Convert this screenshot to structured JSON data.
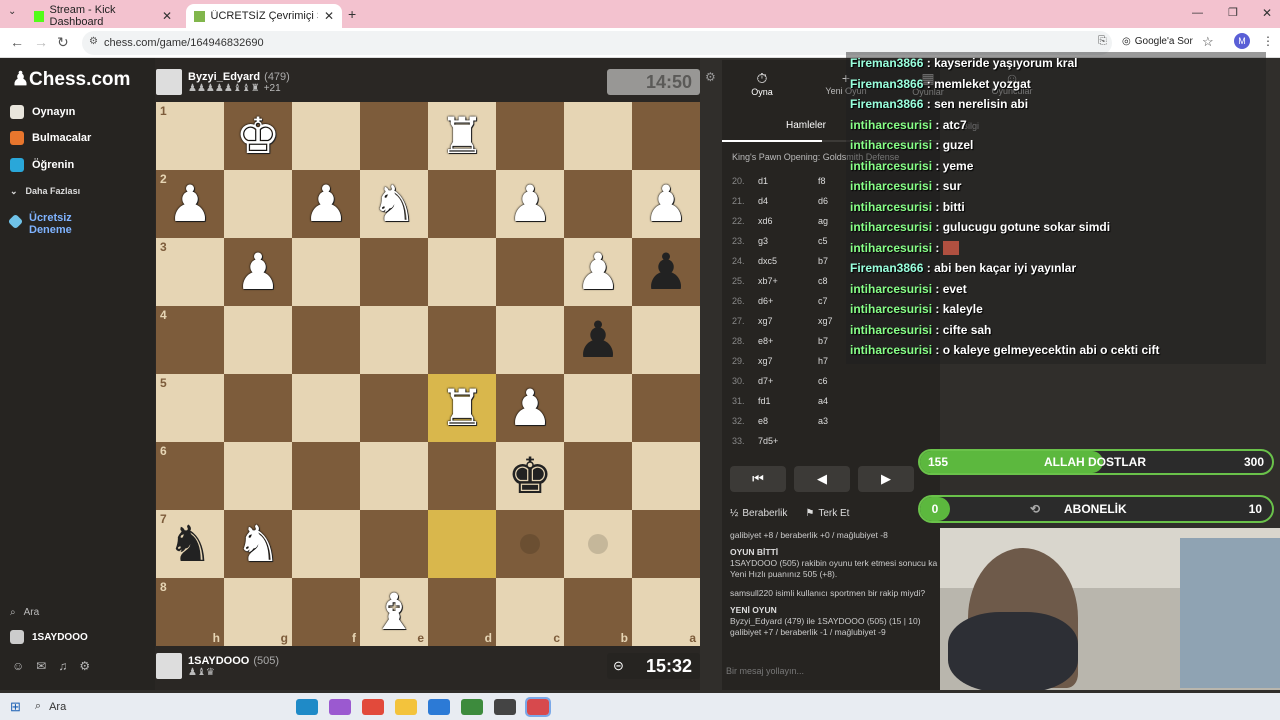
{
  "browser": {
    "tabs": [
      {
        "title": "Stream - Kick Dashboard"
      },
      {
        "title": "ÜCRETSİZ Çevrimiçi Satranç Oy"
      }
    ],
    "url": "chess.com/game/164946832690",
    "google_button": "Google'a Sor",
    "profile_initial": "M"
  },
  "sidebar": {
    "logo": "Chess.com",
    "items": [
      {
        "label": "Oynayın"
      },
      {
        "label": "Bulmacalar"
      },
      {
        "label": "Öğrenin"
      },
      {
        "label": "Daha Fazlası"
      },
      {
        "label": "Ücretsiz Deneme"
      }
    ],
    "search": "Ara",
    "user": "1SAYDOOO"
  },
  "top_player": {
    "name": "Byzyi_Edyard",
    "rating": "(479)",
    "material": "+21",
    "clock": "14:50"
  },
  "bottom_player": {
    "name": "1SAYDOOO",
    "rating": "(505)",
    "clock": "15:32"
  },
  "board": {
    "ranks": [
      "1",
      "2",
      "3",
      "4",
      "5",
      "6",
      "7",
      "8"
    ],
    "files": [
      "h",
      "g",
      "f",
      "e",
      "d",
      "c",
      "b",
      "a"
    ],
    "rows": [
      [
        "",
        "wK",
        "",
        "",
        "wR",
        "",
        "",
        ""
      ],
      [
        "wP",
        "",
        "wP",
        "wN",
        "",
        "wP",
        "",
        "wP"
      ],
      [
        "",
        "wP",
        "",
        "",
        "",
        "",
        "wP",
        "bP"
      ],
      [
        "",
        "",
        "",
        "",
        "",
        "",
        "bP",
        ""
      ],
      [
        "",
        "",
        "",
        "",
        "wR",
        "wP",
        "",
        ""
      ],
      [
        "",
        "",
        "",
        "",
        "",
        "bK",
        "",
        ""
      ],
      [
        "bN",
        "wN",
        "",
        "",
        "",
        "",
        "",
        ""
      ],
      [
        "",
        "",
        "",
        "wB",
        "",
        "",
        "",
        ""
      ]
    ]
  },
  "panel": {
    "tabs": [
      {
        "label": "Oyna"
      },
      {
        "label": "Yeni Oyun"
      },
      {
        "label": "Oyunlar"
      },
      {
        "label": "Oyuncular"
      }
    ],
    "subtabs": [
      {
        "label": "Hamleler"
      },
      {
        "label": "Bilgi"
      }
    ],
    "opening": "King's Pawn Opening: Goldsmith Defense",
    "moves": [
      {
        "n": "20.",
        "w": "d1",
        "b": "f8"
      },
      {
        "n": "21.",
        "w": "d4",
        "b": "d6"
      },
      {
        "n": "22.",
        "w": "xd6",
        "b": "ag"
      },
      {
        "n": "23.",
        "w": "g3",
        "b": "c5"
      },
      {
        "n": "24.",
        "w": "dxc5",
        "b": "b7"
      },
      {
        "n": "25.",
        "w": "xb7+",
        "b": "c8"
      },
      {
        "n": "26.",
        "w": "d6+",
        "b": "c7"
      },
      {
        "n": "27.",
        "w": "xg7",
        "b": "xg7"
      },
      {
        "n": "28.",
        "w": "e8+",
        "b": "b7"
      },
      {
        "n": "29.",
        "w": "xg7",
        "b": "h7"
      },
      {
        "n": "30.",
        "w": "d7+",
        "b": "c6"
      },
      {
        "n": "31.",
        "w": "fd1",
        "b": "a4"
      },
      {
        "n": "32.",
        "w": "e8",
        "b": "a3"
      },
      {
        "n": "33.",
        "w": "7d5+",
        "b": ""
      }
    ],
    "draw": "Beraberlik",
    "resign": "Terk Et",
    "info": [
      "galibiyet +8 / beraberlik +0 / mağlubiyet -8",
      "OYUN BİTTİ",
      "1SAYDOOO (505) rakibin oyunu terk etmesi sonucu ka",
      "Yeni Hızlı puanınız 505 (+8).",
      "samsull220 isimli kullanıcı sportmen bir rakip miydi?",
      "YENİ OYUN",
      "Byzyi_Edyard (479) ile 1SAYDOOO (505) (15 | 10)",
      "galibiyet +7 / beraberlik -1 / mağlubiyet -9"
    ],
    "chat_placeholder": "Bir mesaj yollayın..."
  },
  "chat": [
    {
      "user": "Fireman3866",
      "msg": "kayseride yaşıyorum kral"
    },
    {
      "user": "Fireman3866",
      "msg": "memleket yozgat"
    },
    {
      "user": "Fireman3866",
      "msg": "sen nerelisin abi"
    },
    {
      "user": "intiharcesurisi",
      "msg": "atc7"
    },
    {
      "user": "intiharcesurisi",
      "msg": "guzel"
    },
    {
      "user": "intiharcesurisi",
      "msg": "yeme"
    },
    {
      "user": "intiharcesurisi",
      "msg": "sur"
    },
    {
      "user": "intiharcesurisi",
      "msg": "bitti"
    },
    {
      "user": "intiharcesurisi",
      "msg": "gulucugu gotune sokar simdi"
    },
    {
      "user": "intiharcesurisi",
      "msg": ""
    },
    {
      "user": "Fireman3866",
      "msg": "abi ben kaçar iyi yayınlar"
    },
    {
      "user": "intiharcesurisi",
      "msg": "evet"
    },
    {
      "user": "intiharcesurisi",
      "msg": "kaleyle"
    },
    {
      "user": "intiharcesurisi",
      "msg": "cifte sah"
    },
    {
      "user": "intiharcesurisi",
      "msg": "o kaleye gelmeyecektin abi o cekti cift"
    }
  ],
  "goals": [
    {
      "current": "155",
      "label": "ALLAH DOSTLAR",
      "target": "300",
      "fraction": 0.52
    },
    {
      "current": "0",
      "label": "ABONELİK",
      "target": "10",
      "fraction": 0.0
    }
  ],
  "taskbar": {
    "search": "Ara"
  }
}
